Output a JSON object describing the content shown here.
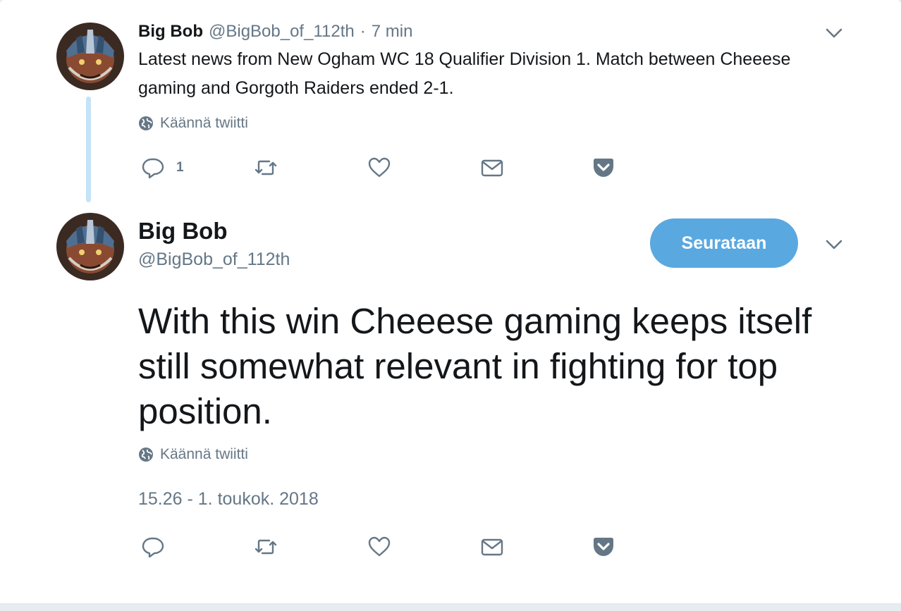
{
  "tweet1": {
    "name": "Big Bob",
    "handle": "@BigBob_of_112th",
    "separator": "·",
    "time": "7 min",
    "text": "Latest news from New Ogham WC 18 Qualifier Division 1. Match between Cheeese gaming and Gorgoth  Raiders ended 2-1.",
    "translate_label": "Käännä twiitti",
    "reply_count": "1"
  },
  "tweet2": {
    "name": "Big Bob",
    "handle": "@BigBob_of_112th",
    "follow_label": "Seurataan",
    "text": "With this win Cheeese gaming keeps itself still somewhat relevant in fighting for top position.",
    "translate_label": "Käännä twiitti",
    "timestamp": "15.26 - 1. toukok. 2018"
  },
  "colors": {
    "accent": "#5aa8e0",
    "secondary_text": "#657786",
    "thread_line": "#c4e3f9"
  },
  "icons": [
    "reply-icon",
    "retweet-icon",
    "like-icon",
    "direct-message-icon",
    "pocket-icon",
    "globe-icon",
    "chevron-down-icon"
  ]
}
